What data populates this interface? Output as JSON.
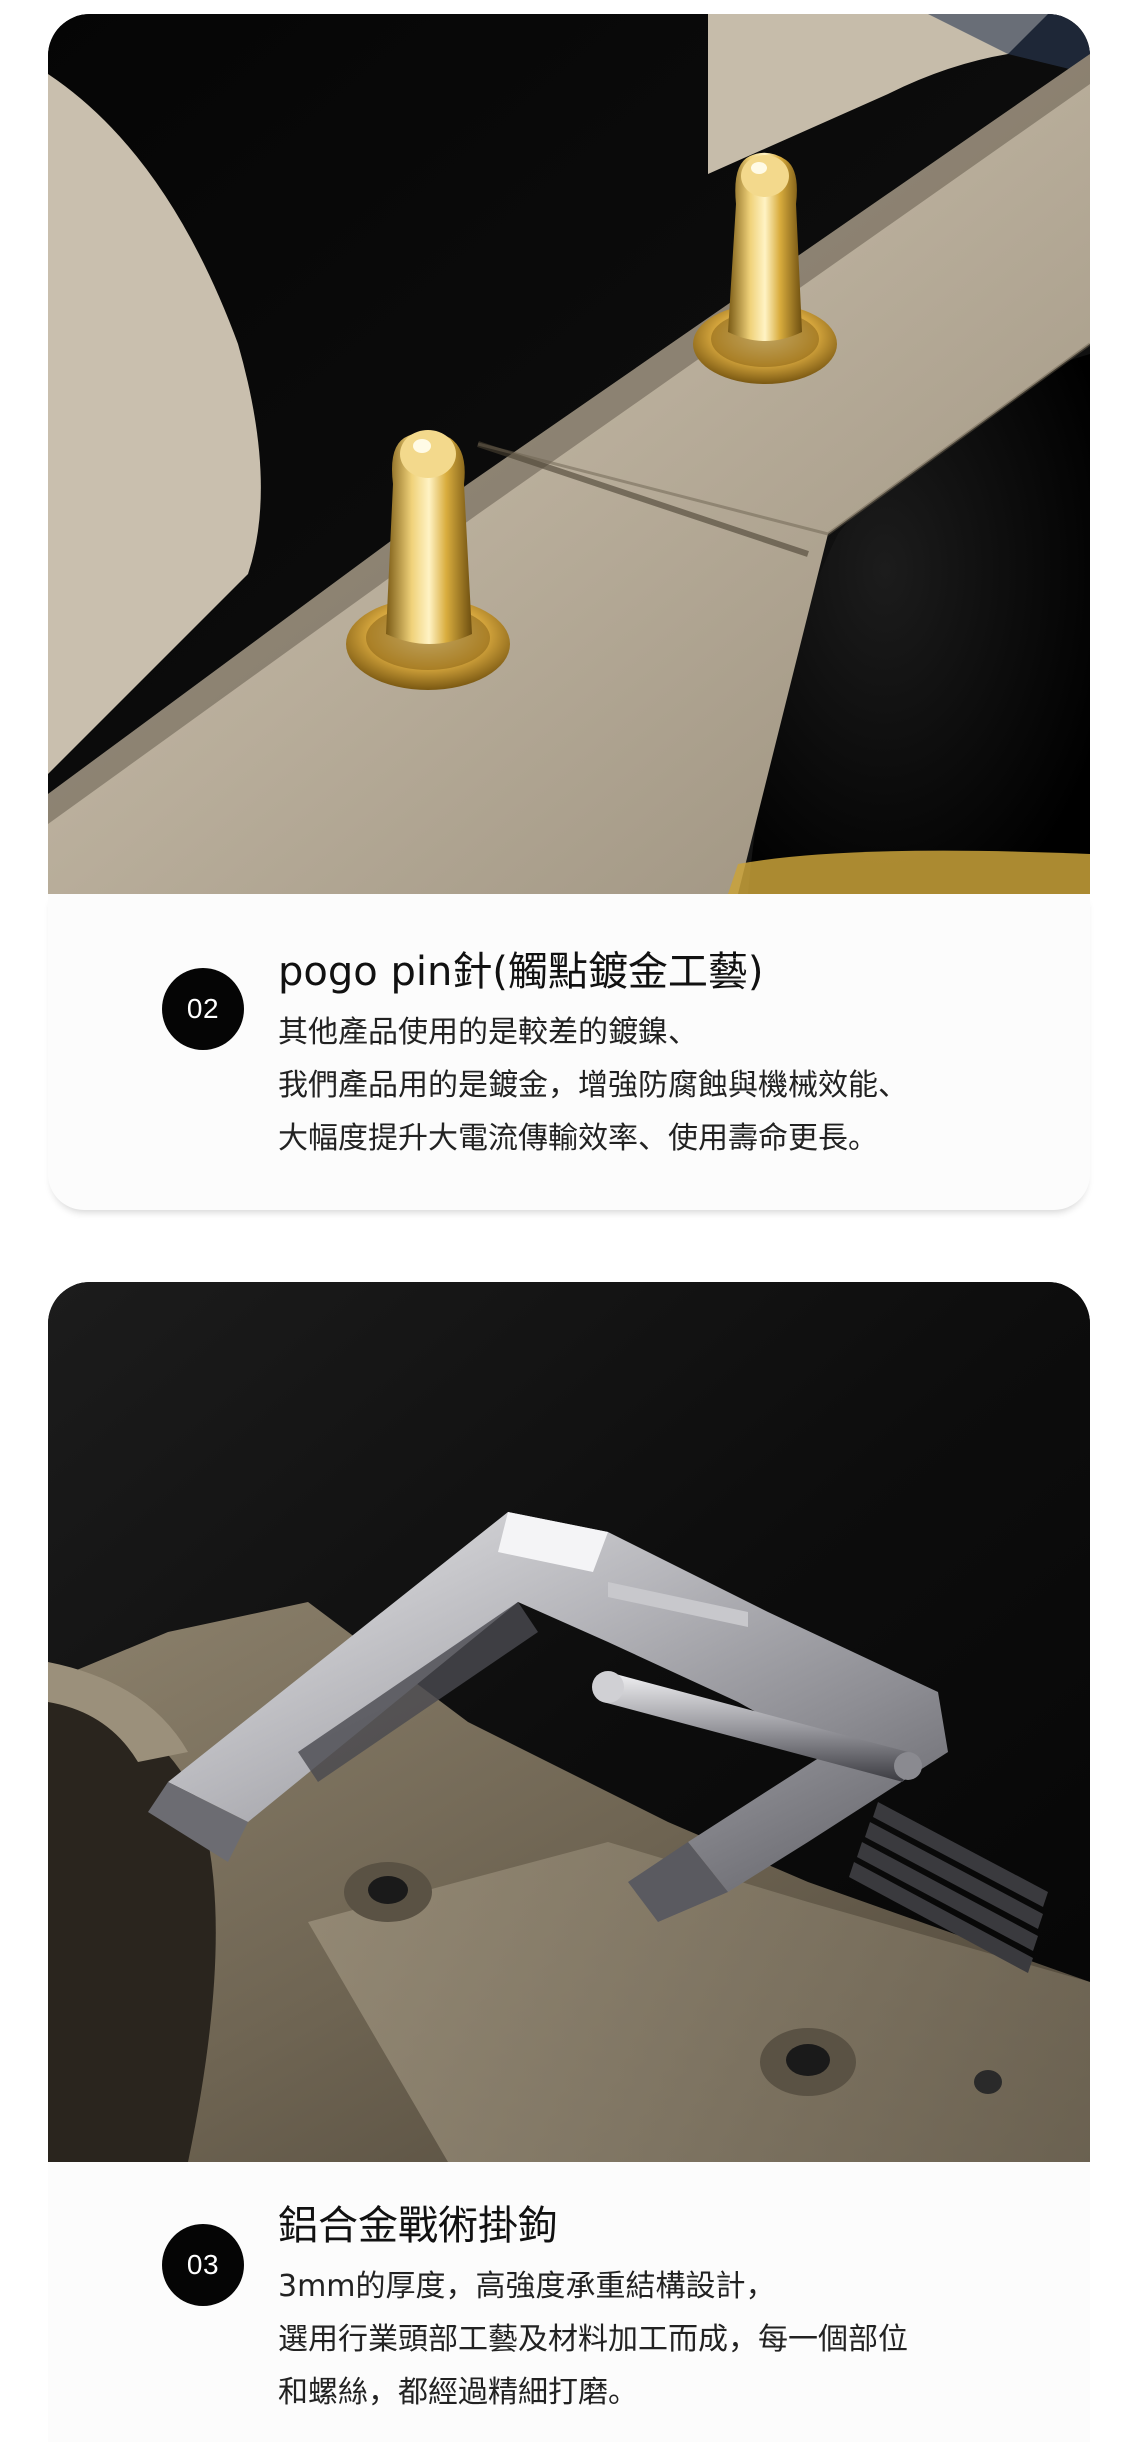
{
  "features": [
    {
      "number": "02",
      "title": "pogo pin針(觸點鍍金工藝)",
      "lines": [
        "其他產品使用的是較差的鍍鎳、",
        "我們產品用的是鍍金，增強防腐蝕與機械效能、",
        "大幅度提升大電流傳輸效率、使用壽命更長。"
      ],
      "image_icon": "gold-pogo-pins-photo"
    },
    {
      "number": "03",
      "title": "鋁合金戰術掛鉤",
      "lines": [
        "3mm的厚度，高強度承重結構設計，",
        "選用行業頭部工藝及材料加工而成，每一個部位",
        "和螺絲，都經過精細打磨。"
      ],
      "image_icon": "aluminum-hook-photo"
    }
  ],
  "colors": {
    "badge_bg": "#050505",
    "badge_text": "#ffffff",
    "card_bg": "#fcfcfc",
    "gold": "#c9a23a",
    "khaki": "#a99f8e"
  }
}
